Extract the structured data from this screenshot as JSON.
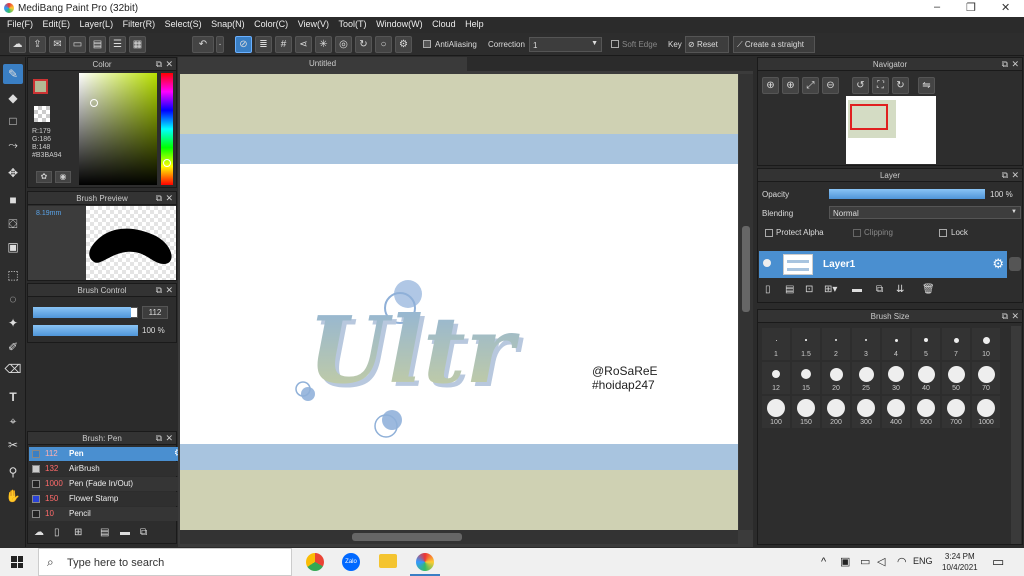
{
  "window": {
    "title": "MediBang Paint Pro (32bit)",
    "minimize": "–",
    "maximize": "❐",
    "close": "✕"
  },
  "menu": [
    "File(F)",
    "Edit(E)",
    "Layer(L)",
    "Filter(R)",
    "Select(S)",
    "Snap(N)",
    "Color(C)",
    "View(V)",
    "Tool(T)",
    "Window(W)",
    "Cloud",
    "Help"
  ],
  "toolbar": {
    "antialiasing": "AntiAliasing",
    "correction_label": "Correction",
    "correction_value": "1",
    "soft_edge": "Soft Edge",
    "key": "Key",
    "reset": "Reset",
    "create_straight": "Create a straight"
  },
  "color_panel": {
    "title": "Color",
    "r": "R:179",
    "g": "G:186",
    "b": "B:148",
    "hex": "#B3BA94",
    "fg": "#B3BA94"
  },
  "brush_preview": {
    "title": "Brush Preview",
    "size": "8.19mm"
  },
  "brush_control": {
    "title": "Brush Control",
    "size_value": "112",
    "opacity_value": "100 %",
    "size_fraction": 0.93,
    "opacity_fraction": 1.0
  },
  "brush_list": {
    "title": "Brush: Pen",
    "items": [
      {
        "size": "112",
        "name": "Pen",
        "color": "#3a7fc4",
        "active": true
      },
      {
        "size": "132",
        "name": "AirBrush",
        "color": "#cccccc",
        "active": false
      },
      {
        "size": "1000",
        "name": "Pen (Fade In/Out)",
        "color": "#222222",
        "active": false
      },
      {
        "size": "150",
        "name": "Flower Stamp",
        "color": "#2a43d8",
        "active": false
      },
      {
        "size": "10",
        "name": "Pencil",
        "color": "#222222",
        "active": false
      }
    ]
  },
  "canvas": {
    "tab": "Untitled",
    "watermark_line1": "@RoSaReE",
    "watermark_line2": "#hoidap247",
    "art_text": "Ultr"
  },
  "navigator": {
    "title": "Navigator"
  },
  "layer_panel": {
    "title": "Layer",
    "opacity_label": "Opacity",
    "opacity_value": "100 %",
    "blending_label": "Blending",
    "blending_value": "Normal",
    "protect_alpha": "Protect Alpha",
    "clipping": "Clipping",
    "lock": "Lock",
    "layer_name": "Layer1"
  },
  "brush_size": {
    "title": "Brush Size",
    "sizes": [
      "1",
      "1.5",
      "2",
      "3",
      "4",
      "5",
      "7",
      "10",
      "12",
      "15",
      "20",
      "25",
      "30",
      "40",
      "50",
      "70",
      "100",
      "150",
      "200",
      "300",
      "400",
      "500",
      "700",
      "1000"
    ]
  },
  "taskbar": {
    "search_placeholder": "Type here to search",
    "time": "3:24 PM",
    "date": "10/4/2021",
    "lang": "ENG"
  }
}
